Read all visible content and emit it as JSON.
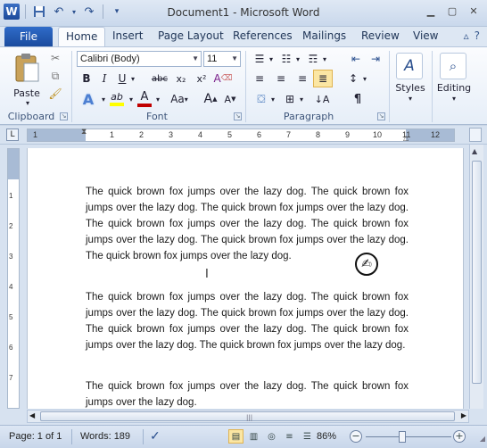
{
  "app": {
    "title": "Document1 - Microsoft Word",
    "logo": "W"
  },
  "qat": {
    "icons": [
      "save-icon",
      "undo-icon",
      "redo-icon",
      "customize-icon"
    ]
  },
  "tabs": {
    "file": "File",
    "home": "Home",
    "insert": "Insert",
    "page_layout": "Page Layout",
    "references": "References",
    "mailings": "Mailings",
    "review": "Review",
    "view": "View"
  },
  "ribbon": {
    "clipboard": {
      "label": "Clipboard",
      "paste": "Paste"
    },
    "font": {
      "label": "Font",
      "font_name": "Calibri (Body)",
      "font_size": "11",
      "bold": "B",
      "italic": "I",
      "underline": "U",
      "strike": "abc",
      "subscript": "x₂",
      "superscript": "x²",
      "grow": "A",
      "shrink": "A",
      "change_case": "Aa",
      "clear_format": "A",
      "highlight": "ab",
      "font_color": "A"
    },
    "paragraph": {
      "label": "Paragraph",
      "pilcrow": "¶"
    },
    "styles": {
      "label": "Styles"
    },
    "editing": {
      "label": "Editing"
    }
  },
  "ruler": {
    "numbers": [
      "1",
      "2",
      "3",
      "4",
      "5",
      "6",
      "7",
      "8",
      "9",
      "10",
      "11",
      "12"
    ],
    "vnumbers": [
      "1",
      "2",
      "3",
      "4",
      "5",
      "6",
      "7"
    ]
  },
  "document": {
    "paragraphs": [
      "The quick brown fox jumps over the lazy dog. The quick brown fox jumps over the lazy dog. The quick brown fox jumps over the lazy dog. The quick brown fox jumps over the lazy dog. The quick brown fox jumps over the lazy dog. The quick brown fox jumps over the lazy dog. The quick brown fox jumps over the lazy dog.",
      "The quick brown fox jumps over the lazy dog. The quick brown fox jumps over the lazy dog. The quick brown fox jumps over the lazy dog. The quick brown fox jumps over the lazy dog. The quick brown fox jumps over the lazy dog. The quick brown fox jumps over the lazy dog.",
      "The quick brown fox jumps over the lazy dog. The quick brown fox jumps over the lazy dog."
    ]
  },
  "status": {
    "page": "Page: 1 of 1",
    "words": "Words: 189",
    "zoom": "86%",
    "zoom_minus": "−",
    "zoom_plus": "+"
  },
  "colors": {
    "accent": "#2f6bc9",
    "highlight_yellow": "#ffff00",
    "font_red": "#c00000"
  }
}
